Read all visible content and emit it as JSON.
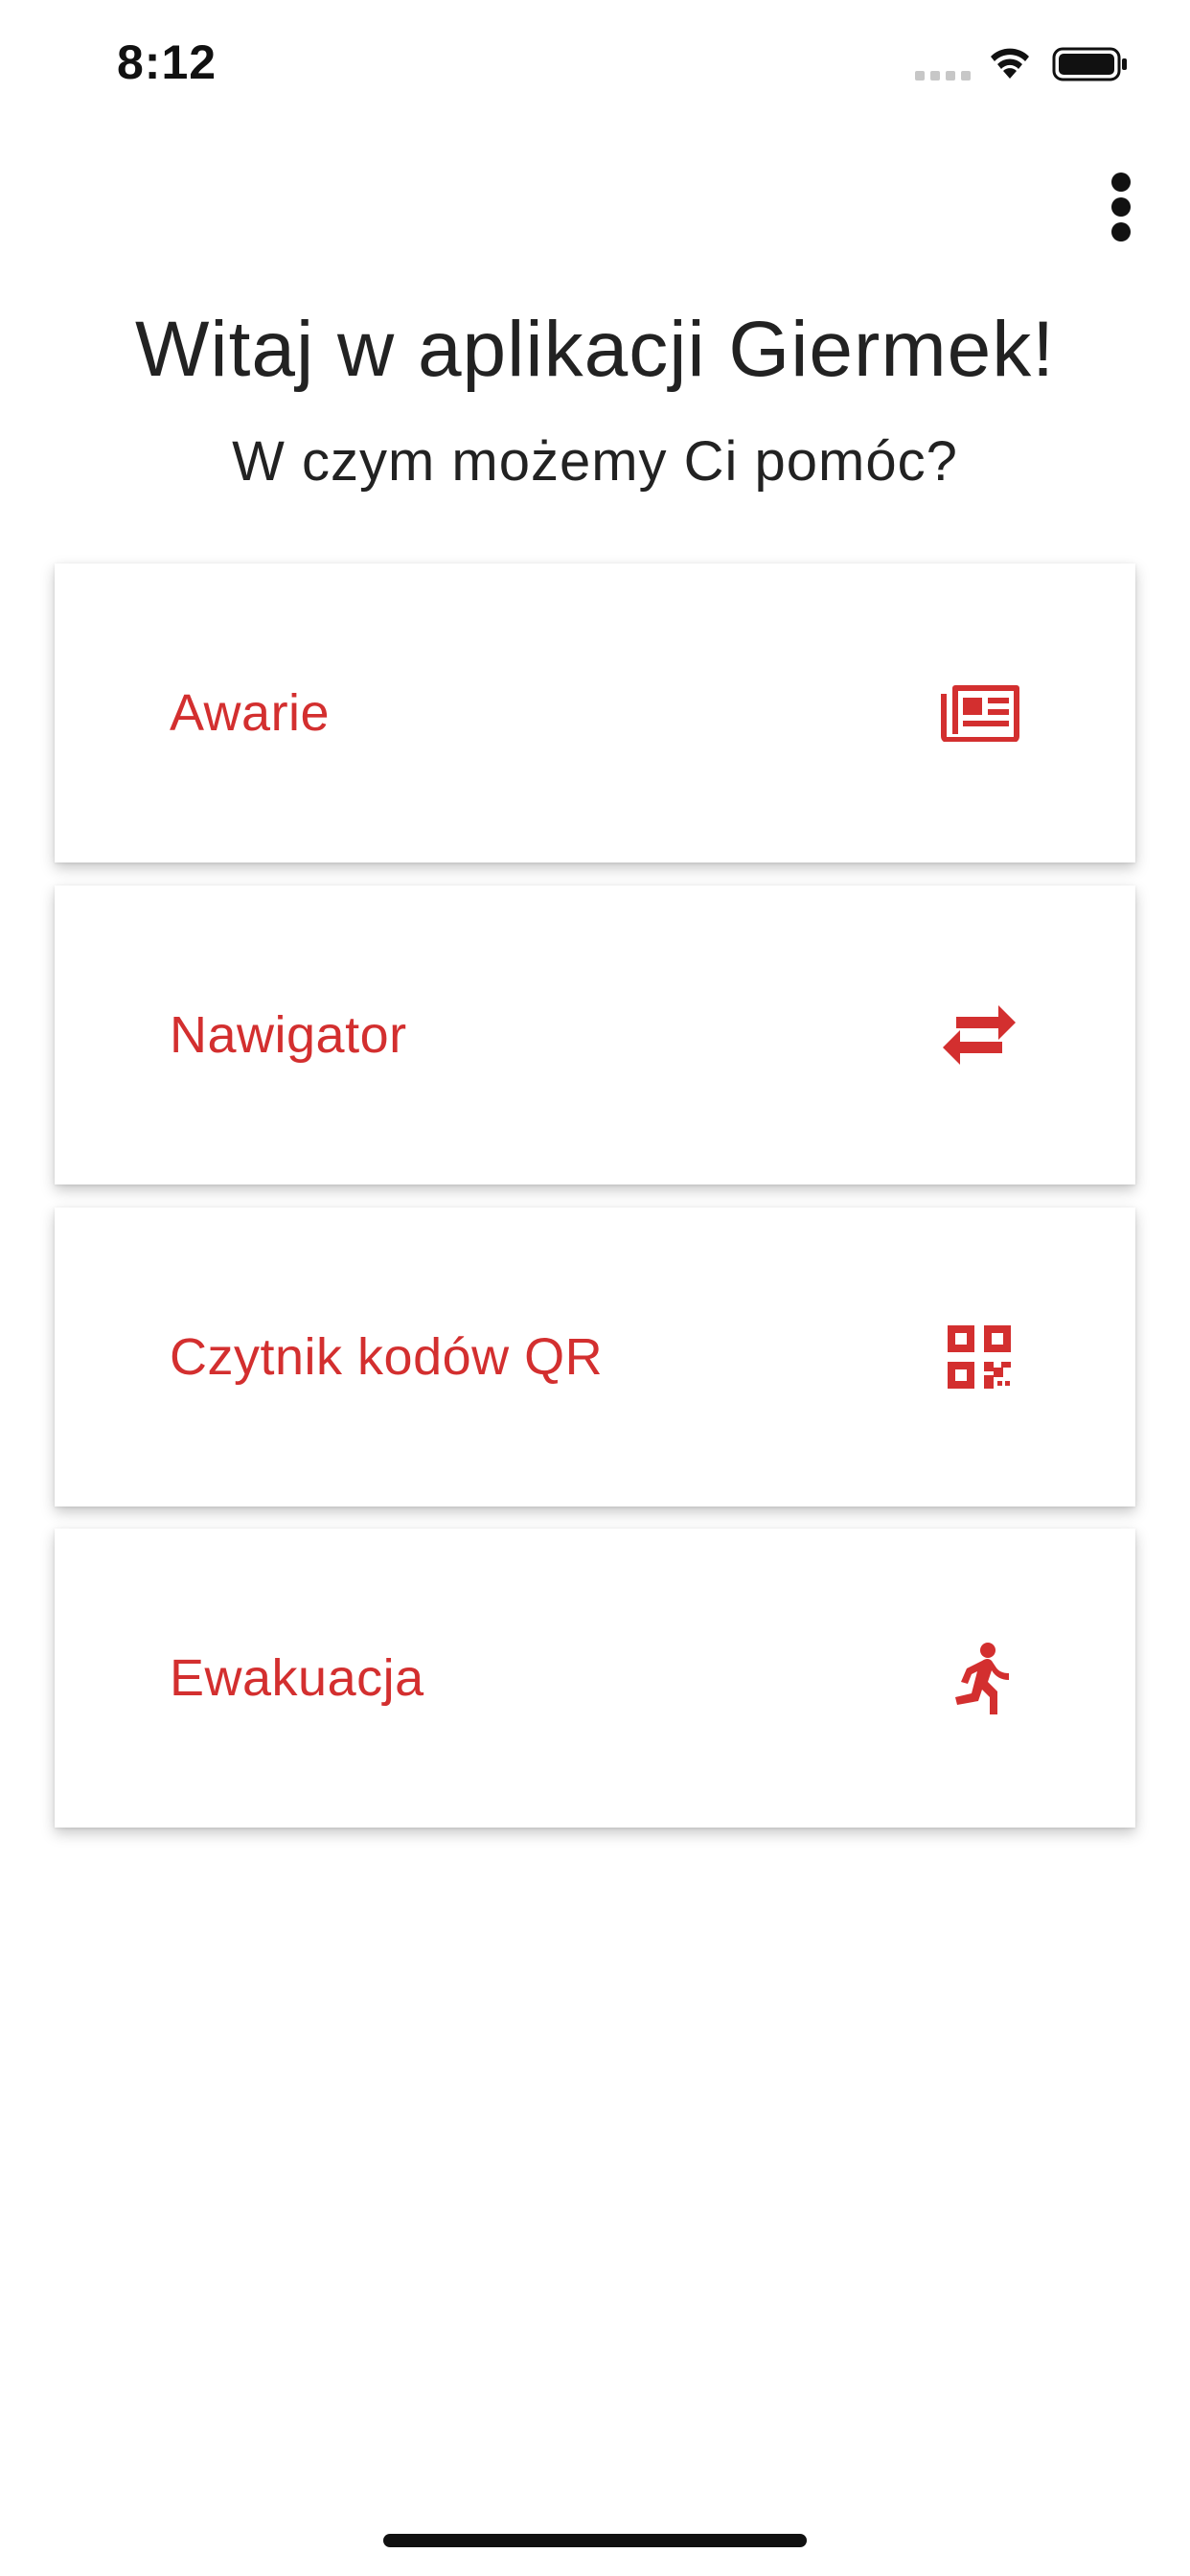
{
  "status_bar": {
    "time": "8:12"
  },
  "icons": {
    "menu": "more-vert-icon",
    "awarie": "newspaper-icon",
    "nawigator": "swap-horiz-icon",
    "qr": "qr-code-icon",
    "ewakuacja": "running-person-icon"
  },
  "header": {
    "title": "Witaj w aplikacji Giermek!",
    "subtitle": "W czym możemy Ci pomóc?"
  },
  "menu_items": [
    {
      "label": "Awarie"
    },
    {
      "label": "Nawigator"
    },
    {
      "label": "Czytnik kodów QR"
    },
    {
      "label": "Ewakuacja"
    }
  ],
  "colors": {
    "accent": "#d32f2f",
    "text": "#222222",
    "background": "#ffffff"
  }
}
